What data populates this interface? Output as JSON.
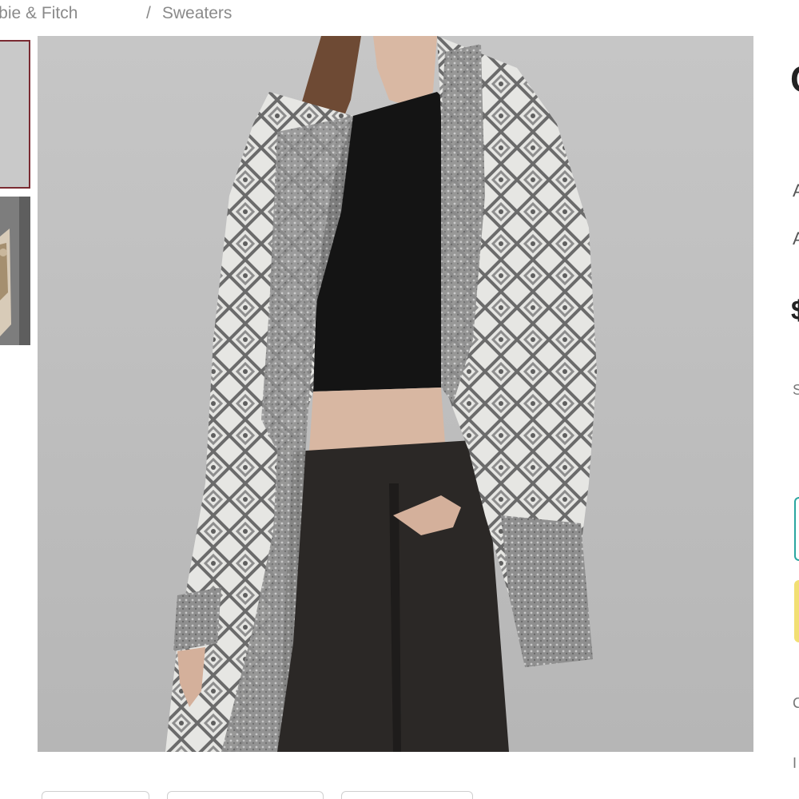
{
  "breadcrumb": {
    "first": "rombie & Fitch",
    "separator": "/",
    "second": "Sweaters"
  },
  "thumbnails": [
    {
      "selected": true
    },
    {
      "selected": false
    }
  ],
  "product_image": {
    "alt": ""
  },
  "right_panel_partial": {
    "glyphs": [
      "C",
      "A",
      "A",
      "$",
      "S",
      "C",
      "I"
    ]
  },
  "colors": {
    "breadcrumb_text": "#8a8a8a",
    "thumb_selected_border": "#7a2b32",
    "edge_button_outline": "#2aa6a0",
    "edge_button_fill": "#f2df73"
  }
}
